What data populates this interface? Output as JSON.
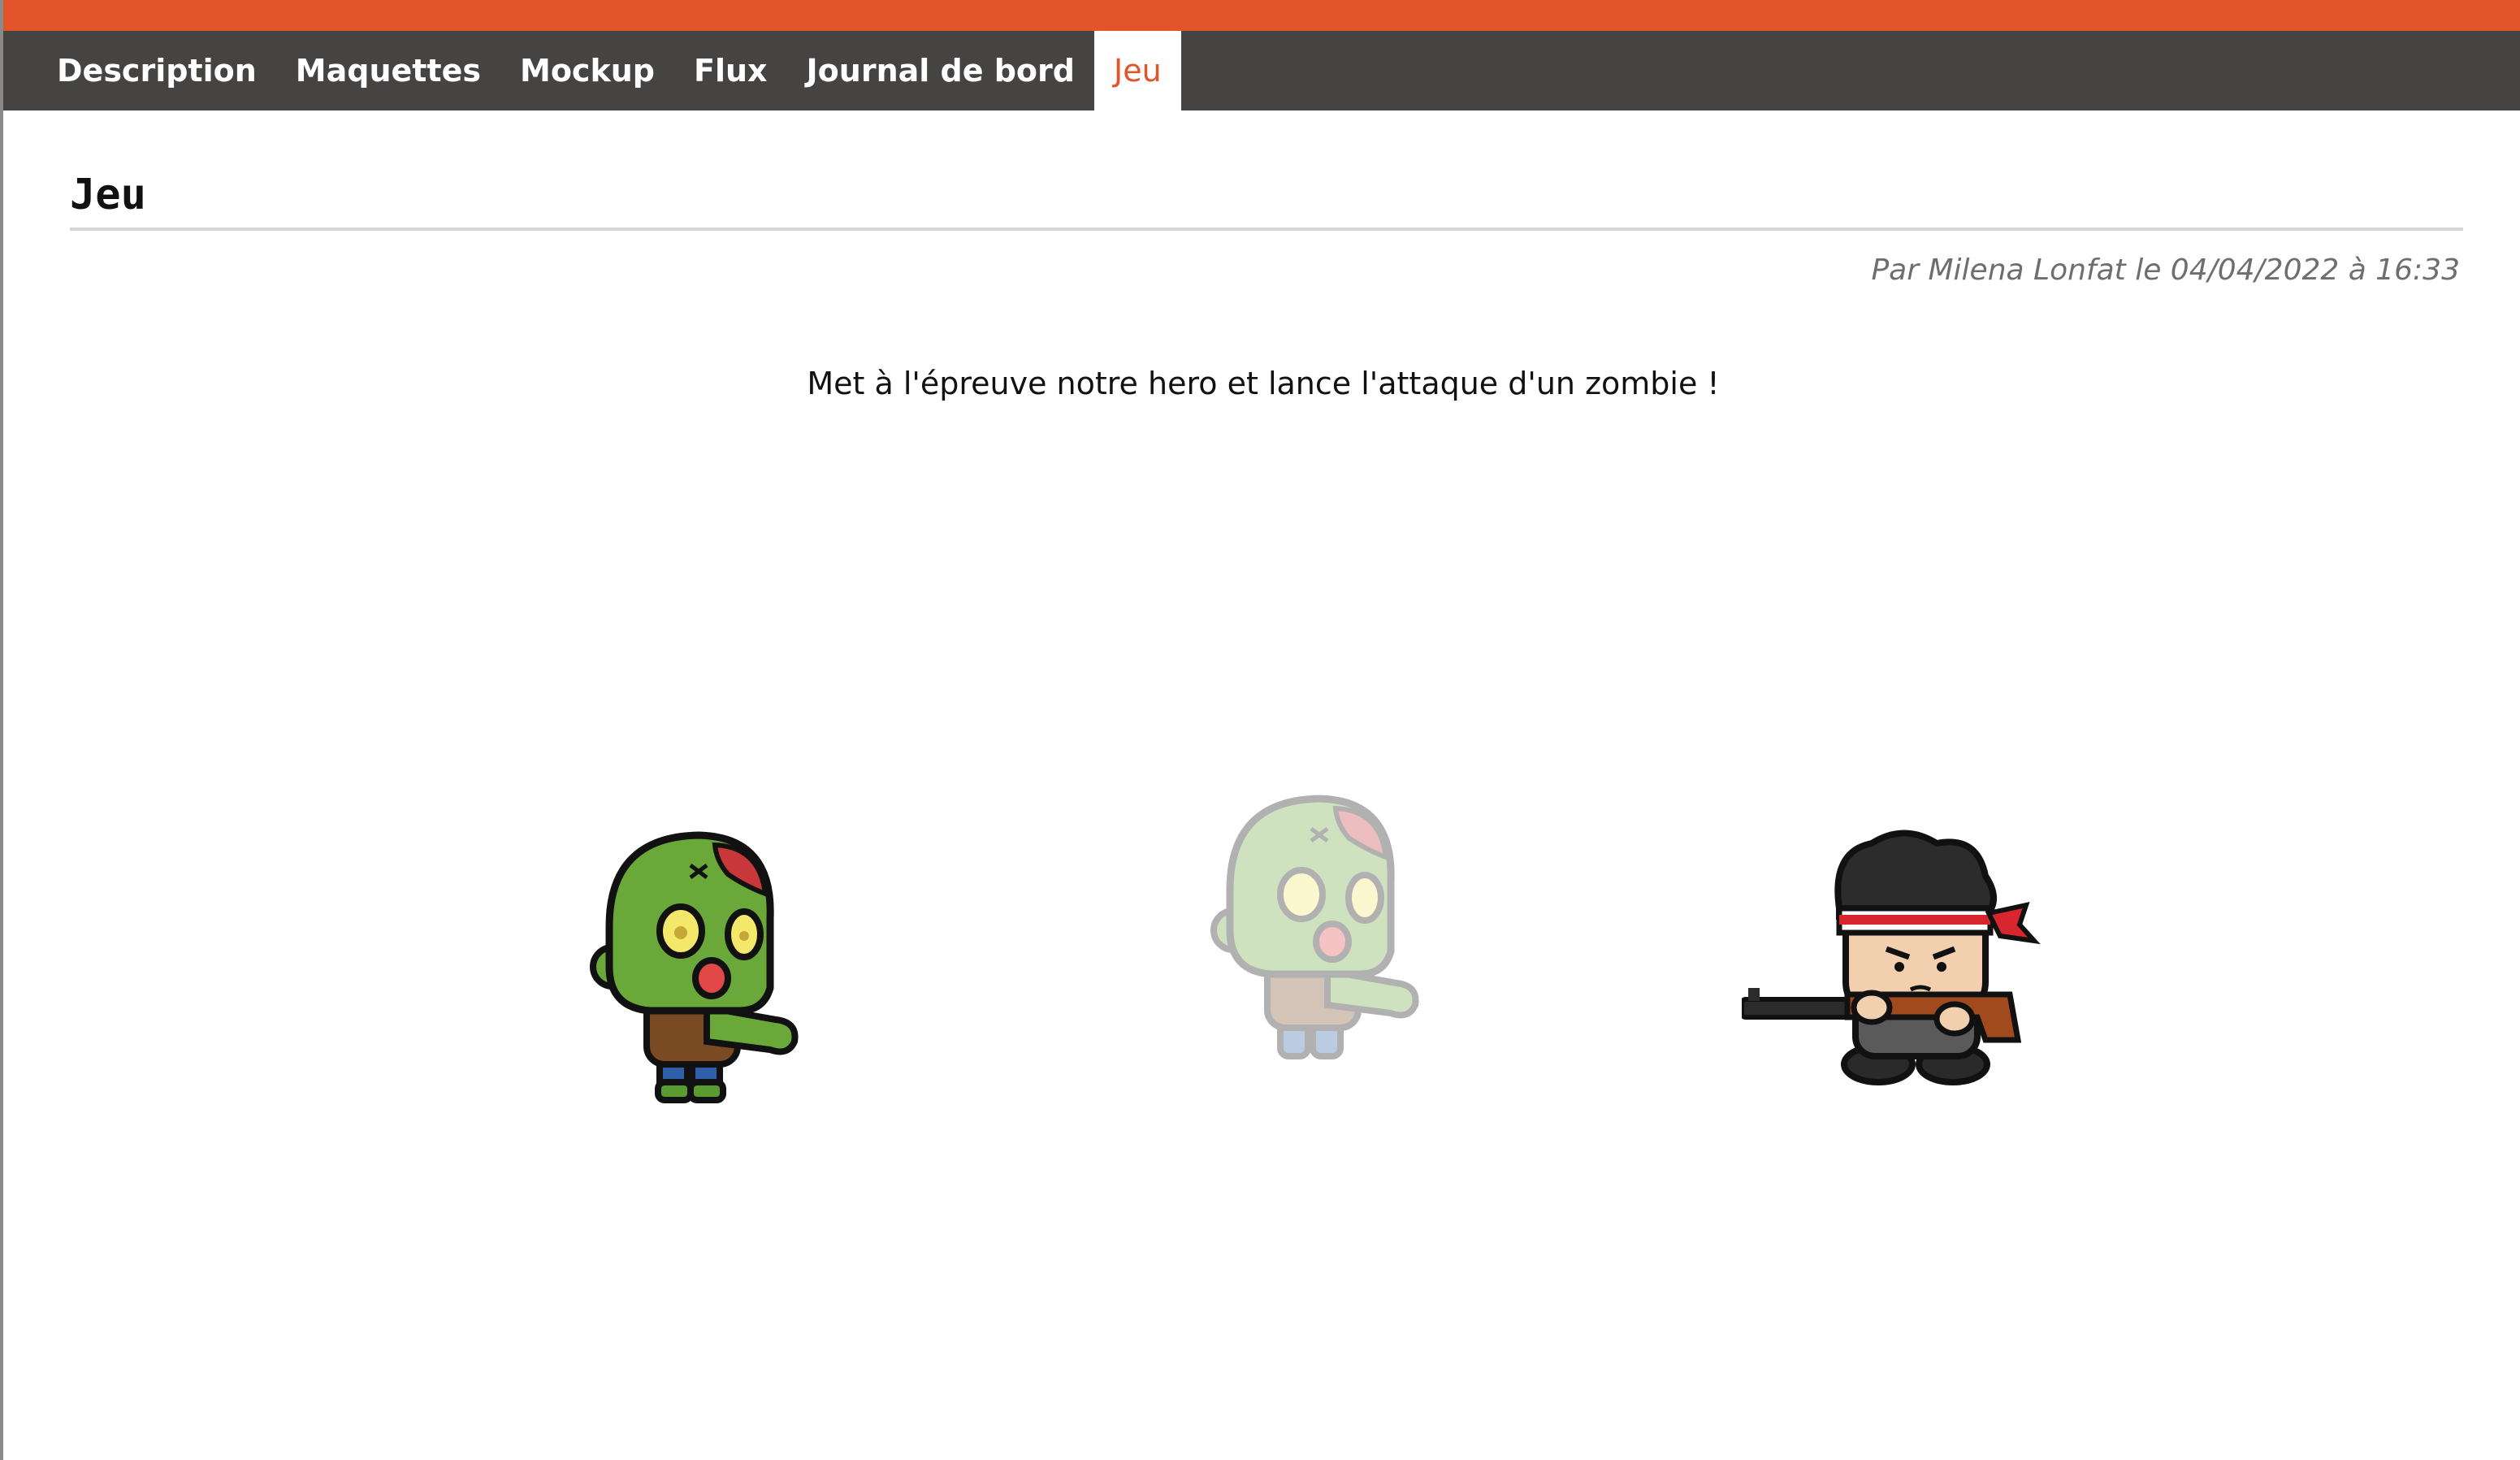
{
  "nav": {
    "items": [
      {
        "label": "Description",
        "active": false
      },
      {
        "label": "Maquettes",
        "active": false
      },
      {
        "label": "Mockup",
        "active": false
      },
      {
        "label": "Flux",
        "active": false
      },
      {
        "label": "Journal de bord",
        "active": false
      },
      {
        "label": "Jeu",
        "active": true
      }
    ]
  },
  "page": {
    "title": "Jeu",
    "byline": "Par Milena Lonfat le 04/04/2022 à 16:33",
    "intro": "Met à l'épreuve notre hero et lance l'attaque d'un zombie !"
  },
  "game": {
    "sprites": [
      {
        "name": "zombie",
        "state": "idle"
      },
      {
        "name": "zombie",
        "state": "ghost"
      },
      {
        "name": "hero",
        "state": "aiming"
      }
    ]
  },
  "colors": {
    "accent": "#e2542a",
    "navbar": "#464343",
    "zombie_skin": "#6aa83a",
    "hero_headband": "#d8262f"
  }
}
